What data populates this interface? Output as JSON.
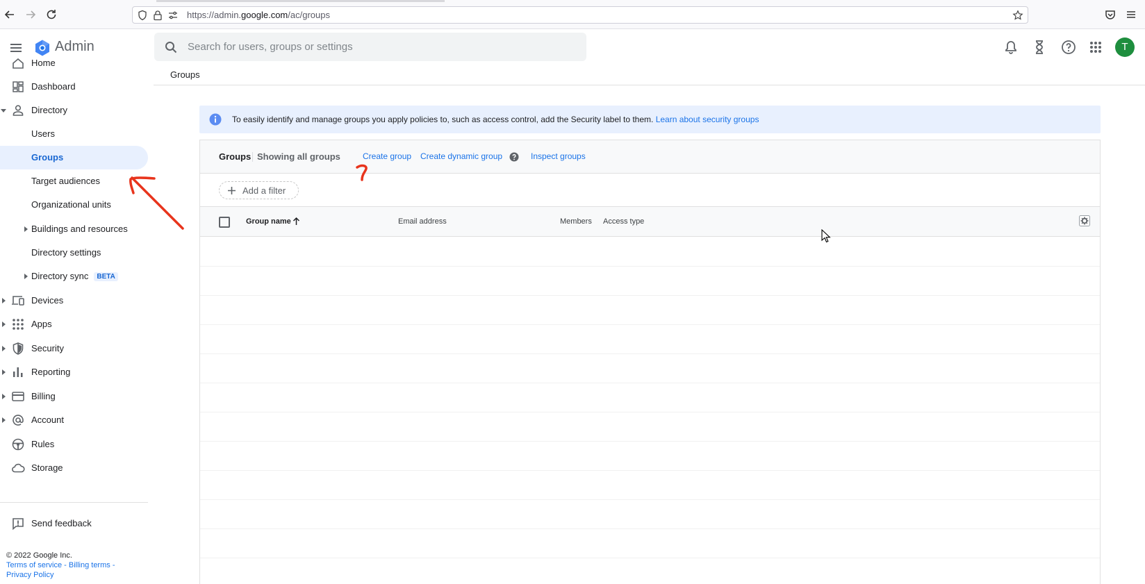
{
  "browser": {
    "url_prefix": "https://admin.",
    "url_domain": "google.com",
    "url_path": "/ac/groups"
  },
  "header": {
    "app_name": "Admin",
    "search_placeholder": "Search for users, groups or settings",
    "avatar_letter": "T"
  },
  "breadcrumb": "Groups",
  "sidebar": {
    "cut_item": "Home",
    "items": [
      {
        "label": "Dashboard"
      },
      {
        "label": "Directory"
      },
      {
        "label": "Users"
      },
      {
        "label": "Groups"
      },
      {
        "label": "Target audiences"
      },
      {
        "label": "Organizational units"
      },
      {
        "label": "Buildings and resources"
      },
      {
        "label": "Directory settings"
      },
      {
        "label": "Directory sync",
        "badge": "BETA"
      },
      {
        "label": "Devices"
      },
      {
        "label": "Apps"
      },
      {
        "label": "Security"
      },
      {
        "label": "Reporting"
      },
      {
        "label": "Billing"
      },
      {
        "label": "Account"
      },
      {
        "label": "Rules"
      },
      {
        "label": "Storage"
      }
    ],
    "feedback": "Send feedback",
    "copyright": "© 2022 Google Inc.",
    "terms": "Terms of service",
    "billing_terms": "Billing terms",
    "privacy": "Privacy Policy",
    "link_sep": " - "
  },
  "banner": {
    "text": "To easily identify and manage groups you apply policies to, such as access control, add the Security label to them. ",
    "link": "Learn about security groups"
  },
  "groups_card": {
    "title": "Groups",
    "subtitle": "Showing all groups",
    "create_group": "Create group",
    "create_dynamic_group": "Create dynamic group",
    "inspect_groups": "Inspect groups",
    "add_filter": "Add a filter",
    "columns": {
      "group_name": "Group name",
      "email": "Email address",
      "members": "Members",
      "access_type": "Access type"
    }
  },
  "colors": {
    "accent": "#1a73e8",
    "active_bg": "#e8f0fe",
    "annotation": "#e8341c",
    "avatar": "#1e8e3e"
  }
}
